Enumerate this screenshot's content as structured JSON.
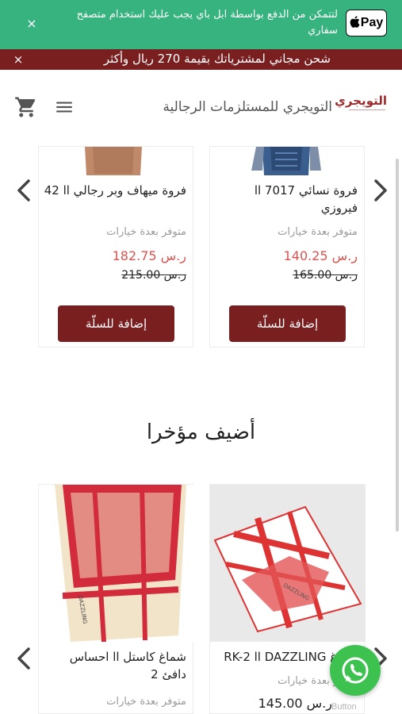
{
  "applepay_banner": {
    "badge_label": "Pay",
    "message": "لتتمكن من الدفع بواسطة ابل باي يجب عليك استخدام متصفح سفاري",
    "close": "×"
  },
  "shipping_banner": {
    "message": "شحن مجاني لمشترياتك بقيمة 270 ريال وأكثر",
    "close": "×"
  },
  "header": {
    "site_name": "التويجري للمستلزمات الرجالية",
    "logo_text": "التويجري"
  },
  "products_row_1": [
    {
      "name": "فروة نسائي 7017 اا فيروزي",
      "availability": "متوفر بعدة خيارات",
      "price": "ر.س 140.25",
      "old_price": "ر.س 165.00",
      "button": "إضافة للسلّة"
    },
    {
      "name": "فروة ميهاف وبر رجالي اا 42",
      "availability": "متوفر بعدة خيارات",
      "price": "ر.س 182.75",
      "old_price": "ر.س 215.00",
      "button": "إضافة للسلّة"
    }
  ],
  "section": {
    "title": "أضيف مؤخرا"
  },
  "products_row_2": [
    {
      "name": "شماغ DAZZLING اا RK-2",
      "availability": "متوفر بعدة خيارات",
      "price": "ر.س 145.00"
    },
    {
      "name": "شماغ كاستل اا احساس دافئ 2",
      "availability": "متوفر بعدة خيارات"
    }
  ],
  "whatsapp": {
    "caption": "Button"
  },
  "colors": {
    "green": "#36b37e",
    "maroon": "#7a1f1f",
    "sale_red": "#d9534f",
    "whatsapp": "#3ec24f"
  }
}
